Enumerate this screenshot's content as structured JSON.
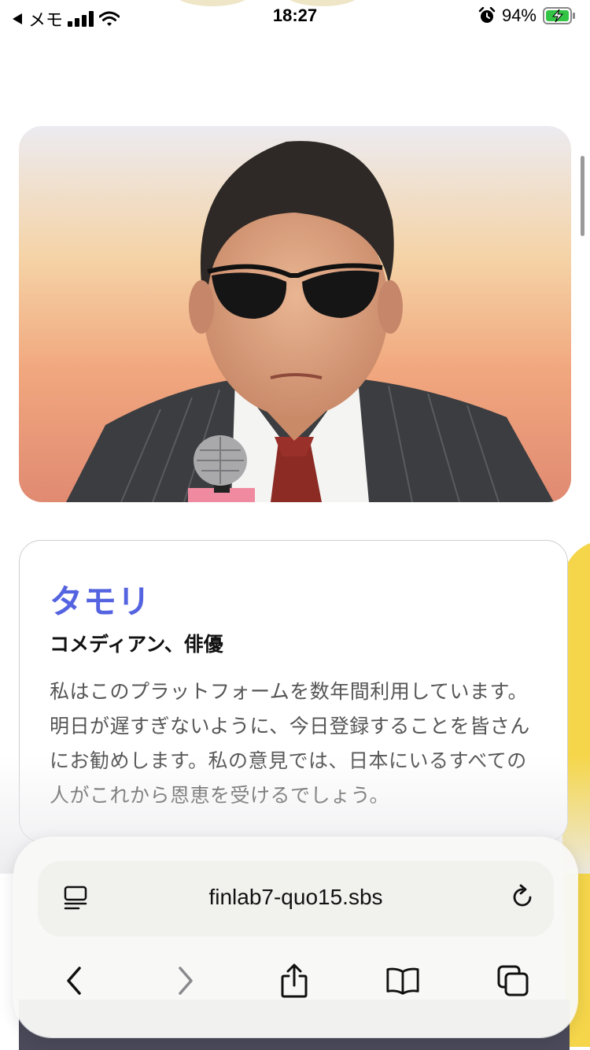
{
  "status_bar": {
    "back_label": "メモ",
    "time": "18:27",
    "battery": "94%",
    "signal_bars": 4,
    "icons": [
      "back-triangle-icon",
      "signal-icon",
      "wifi-icon",
      "alarm-icon",
      "battery-charging-icon"
    ]
  },
  "profile": {
    "name": "タモリ",
    "role": "コメディアン、俳優",
    "quote": "私はこのプラットフォームを数年間利用しています。明日が遅すぎないように、今日登録することを皆さんにお勧めします。私の意見では、日本にいるすべての人がこれから恩恵を受けるでしょう。",
    "name_color": "#5463e0"
  },
  "browser": {
    "url": "finlab7-quo15.sbs",
    "icons": [
      "tabs-overview-icon",
      "reload-icon",
      "back-chevron-icon",
      "forward-chevron-icon",
      "share-icon",
      "bookmarks-icon",
      "tabs-icon"
    ]
  },
  "colors": {
    "accent": "#5463e0",
    "photo_background": "#f2b58a",
    "edge_yellow": "#f5d64a"
  }
}
